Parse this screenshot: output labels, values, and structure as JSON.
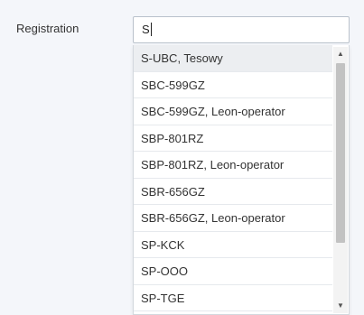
{
  "field": {
    "label": "Registration",
    "value": "S"
  },
  "dropdown": {
    "options": [
      "S-UBC, Tesowy",
      "SBC-599GZ",
      "SBC-599GZ, Leon-operator",
      "SBP-801RZ",
      "SBP-801RZ, Leon-operator",
      "SBR-656GZ",
      "SBR-656GZ, Leon-operator",
      "SP-KCK",
      "SP-OOO",
      "SP-TGE"
    ],
    "highlighted_index": 0,
    "scroll": {
      "up_icon": "triangle-up-icon",
      "down_icon": "triangle-down-icon",
      "thumb_fraction": 0.77
    }
  }
}
